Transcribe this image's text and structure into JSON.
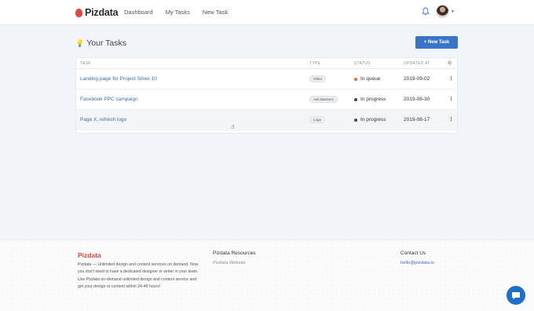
{
  "app": {
    "name": "Pizdata"
  },
  "nav": {
    "items": [
      "Dashboard",
      "My Tasks",
      "New Task"
    ]
  },
  "page": {
    "title": "Your Tasks",
    "new_task_label": "+ New Task"
  },
  "table": {
    "columns": [
      "TASK",
      "TYPE",
      "STATUS",
      "UPDATED AT"
    ],
    "rows": [
      {
        "task": "Landing page for Project Silver 10",
        "type": "Other",
        "status": "In queue",
        "status_color": "#e8693a",
        "updated": "2019-09-02"
      },
      {
        "task": "Facebook PPC campaign",
        "type": "Ads Banners",
        "status": "In progress",
        "status_color": "#2a4a8a",
        "updated": "2019-08-30"
      },
      {
        "task": "Page X, refresh logo",
        "type": "Logo",
        "status": "In progress",
        "status_color": "#2a4a8a",
        "updated": "2019-08-17"
      }
    ]
  },
  "footer": {
    "brand": "Pizdata",
    "description": "Pizdata — Unlimited design and content services on demand. Now you don't need to have a dedicated designer or writer in your team. Use Pizdata on-demand unlimited design and content service and get your design or content within 24-48 hours!",
    "resources_title": "Pizdata Resources",
    "resources_link": "Pizdata Website",
    "contact_title": "Contact Us",
    "contact_email": "hello@pizdata.io"
  },
  "colors": {
    "brand": "#e2483d",
    "primary": "#3a74c9",
    "link": "#3a6fb7"
  },
  "icons": [
    "bell-icon",
    "avatar",
    "lightbulb-icon",
    "gear-icon",
    "kebab-icon",
    "chat-icon"
  ]
}
